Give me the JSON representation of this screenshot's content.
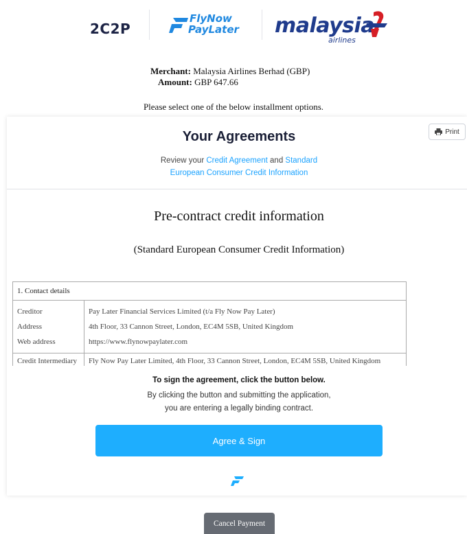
{
  "header": {
    "logo_2c2p": "2C2P",
    "logo_flynow": "FlyNow",
    "logo_paylater": "PayLater",
    "logo_malaysia": "malaysia",
    "logo_airlines": "airlines"
  },
  "merchant": {
    "merchant_label": "Merchant:",
    "merchant_value": "Malaysia Airlines Berhad (GBP)",
    "amount_label": "Amount:",
    "amount_value": "GBP 647.66",
    "instruction": "Please select one of the below installment options."
  },
  "agreements": {
    "title": "Your Agreements",
    "review_prefix": "Review your ",
    "credit_agreement_link": "Credit Agreement",
    "and_text": " and ",
    "secci_link": "Standard European Consumer Credit Information",
    "print_label": "Print"
  },
  "document": {
    "title": "Pre-contract credit information",
    "subtitle": "(Standard European Consumer Credit Information)",
    "section1_header": "1. Contact details",
    "creditor_label": "Creditor",
    "creditor_value": "Pay Later Financial Services Limited (t/a Fly Now Pay Later)",
    "address_label": "Address",
    "address_value": "4th Floor, 33 Cannon Street, London, EC4M 5SB, United Kingdom",
    "web_label": "Web address",
    "web_value": "https://www.flynowpaylater.com",
    "intermediary_label": "Credit Intermediary",
    "intermediary_value": "Fly Now Pay Later Limited, 4th Floor, 33 Cannon Street, London, EC4M 5SB, United Kingdom"
  },
  "sign": {
    "heading": "To sign the agreement, click the button below.",
    "line1": "By clicking the button and submitting the application,",
    "line2": "you are entering a legally binding contract.",
    "agree_label": "Agree & Sign"
  },
  "footer": {
    "cancel_label": "Cancel Payment"
  },
  "colors": {
    "accent": "#1eaefe",
    "link": "#1aa2ff",
    "brand_blue": "#1f3b8c",
    "cancel_bg": "#666b73"
  },
  "icons": [
    "printer-icon",
    "flynow-mark-icon",
    "malaysia-wing-icon"
  ]
}
